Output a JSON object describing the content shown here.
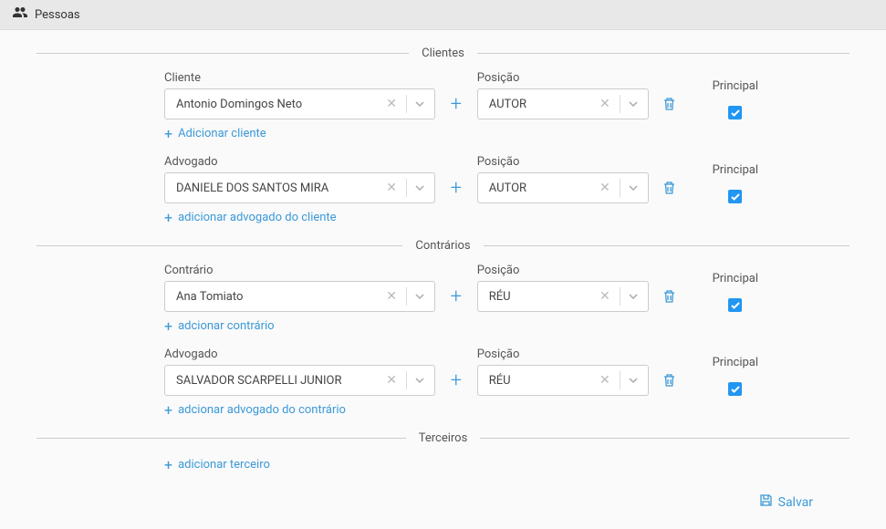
{
  "header": {
    "title": "Pessoas"
  },
  "sections": {
    "clientes": {
      "title": "Clientes",
      "cliente": {
        "label": "Cliente",
        "value": "Antonio Domingos Neto",
        "posicao_label": "Posição",
        "posicao_value": "AUTOR",
        "principal_label": "Principal",
        "principal_checked": true
      },
      "add_cliente": "Adicionar cliente",
      "advogado": {
        "label": "Advogado",
        "value": "DANIELE DOS SANTOS MIRA",
        "posicao_label": "Posição",
        "posicao_value": "AUTOR",
        "principal_label": "Principal",
        "principal_checked": true
      },
      "add_advogado": "adicionar advogado do cliente"
    },
    "contrarios": {
      "title": "Contrários",
      "contrario": {
        "label": "Contrário",
        "value": "Ana Tomiato",
        "posicao_label": "Posição",
        "posicao_value": "RÉU",
        "principal_label": "Principal",
        "principal_checked": true
      },
      "add_contrario": "adcionar contrário",
      "advogado": {
        "label": "Advogado",
        "value": "SALVADOR SCARPELLI JUNIOR",
        "posicao_label": "Posição",
        "posicao_value": "RÉU",
        "principal_label": "Principal",
        "principal_checked": true
      },
      "add_advogado": "adcionar advogado do contrário"
    },
    "terceiros": {
      "title": "Terceiros",
      "add_terceiro": "adicionar terceiro"
    }
  },
  "footer": {
    "save": "Salvar"
  }
}
